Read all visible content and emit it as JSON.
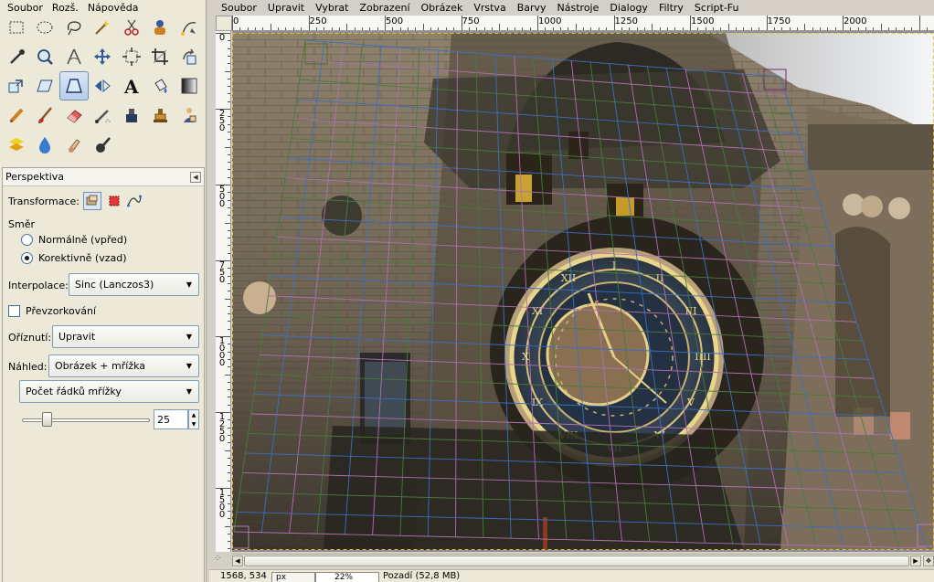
{
  "toolbox": {
    "menu": [
      "Soubor",
      "Rozš.",
      "Nápověda"
    ],
    "tools": [
      {
        "icon": "rect-select-icon"
      },
      {
        "icon": "ellipse-select-icon"
      },
      {
        "icon": "lasso-icon"
      },
      {
        "icon": "fuzzy-select-icon"
      },
      {
        "icon": "scissors-select-icon"
      },
      {
        "icon": "foreground-select-icon"
      },
      {
        "icon": "paths-icon"
      },
      {
        "icon": "color-picker-icon"
      },
      {
        "icon": "zoom-icon"
      },
      {
        "icon": "measure-icon"
      },
      {
        "icon": "move-icon"
      },
      {
        "icon": "align-icon"
      },
      {
        "icon": "crop-icon"
      },
      {
        "icon": "rotate-icon"
      },
      {
        "icon": "scale-icon"
      },
      {
        "icon": "shear-icon"
      },
      {
        "icon": "perspective-icon",
        "active": true
      },
      {
        "icon": "flip-icon"
      },
      {
        "icon": "text-icon"
      },
      {
        "icon": "bucket-fill-icon"
      },
      {
        "icon": "blend-icon"
      },
      {
        "icon": "pencil-icon"
      },
      {
        "icon": "paintbrush-icon"
      },
      {
        "icon": "eraser-icon"
      },
      {
        "icon": "airbrush-icon"
      },
      {
        "icon": "ink-icon"
      },
      {
        "icon": "clone-icon"
      },
      {
        "icon": "heal-icon"
      },
      {
        "icon": "perspective-clone-icon"
      },
      {
        "icon": "blur-icon"
      },
      {
        "icon": "smudge-icon"
      },
      {
        "icon": "dodge-burn-icon"
      }
    ]
  },
  "options": {
    "tab_title": "Perspektiva",
    "transform_label": "Transformace:",
    "direction_label": "Směr",
    "direction_normal": "Normálně (vpřed)",
    "direction_corrective": "Korektivně (vzad)",
    "interpolation_label": "Interpolace:",
    "interpolation_value": "Sinc (Lanczos3)",
    "supersampling_label": "Převzorkování",
    "clipping_label": "Oříznutí:",
    "clipping_value": "Upravit",
    "preview_label": "Náhled:",
    "preview_value": "Obrázek + mřížka",
    "grid_type_value": "Počet řádků mřížky",
    "grid_lines_value": "25"
  },
  "image_window": {
    "menu": [
      "Soubor",
      "Upravit",
      "Vybrat",
      "Zobrazení",
      "Obrázek",
      "Vrstva",
      "Barvy",
      "Nástroje",
      "Dialogy",
      "Filtry",
      "Script-Fu"
    ],
    "hruler_labels": [
      "0",
      "|250",
      "|500",
      "|750",
      "|1000",
      "|1250",
      "|1500",
      "|1750",
      "|2000"
    ],
    "vruler_labels": [
      "0",
      "250",
      "500",
      "750",
      "1000",
      "1250",
      "1500"
    ],
    "status": {
      "coords": "1568, 534",
      "unit": "px",
      "zoom": "22%",
      "message": "Pozadí (52,8 MB)"
    }
  }
}
